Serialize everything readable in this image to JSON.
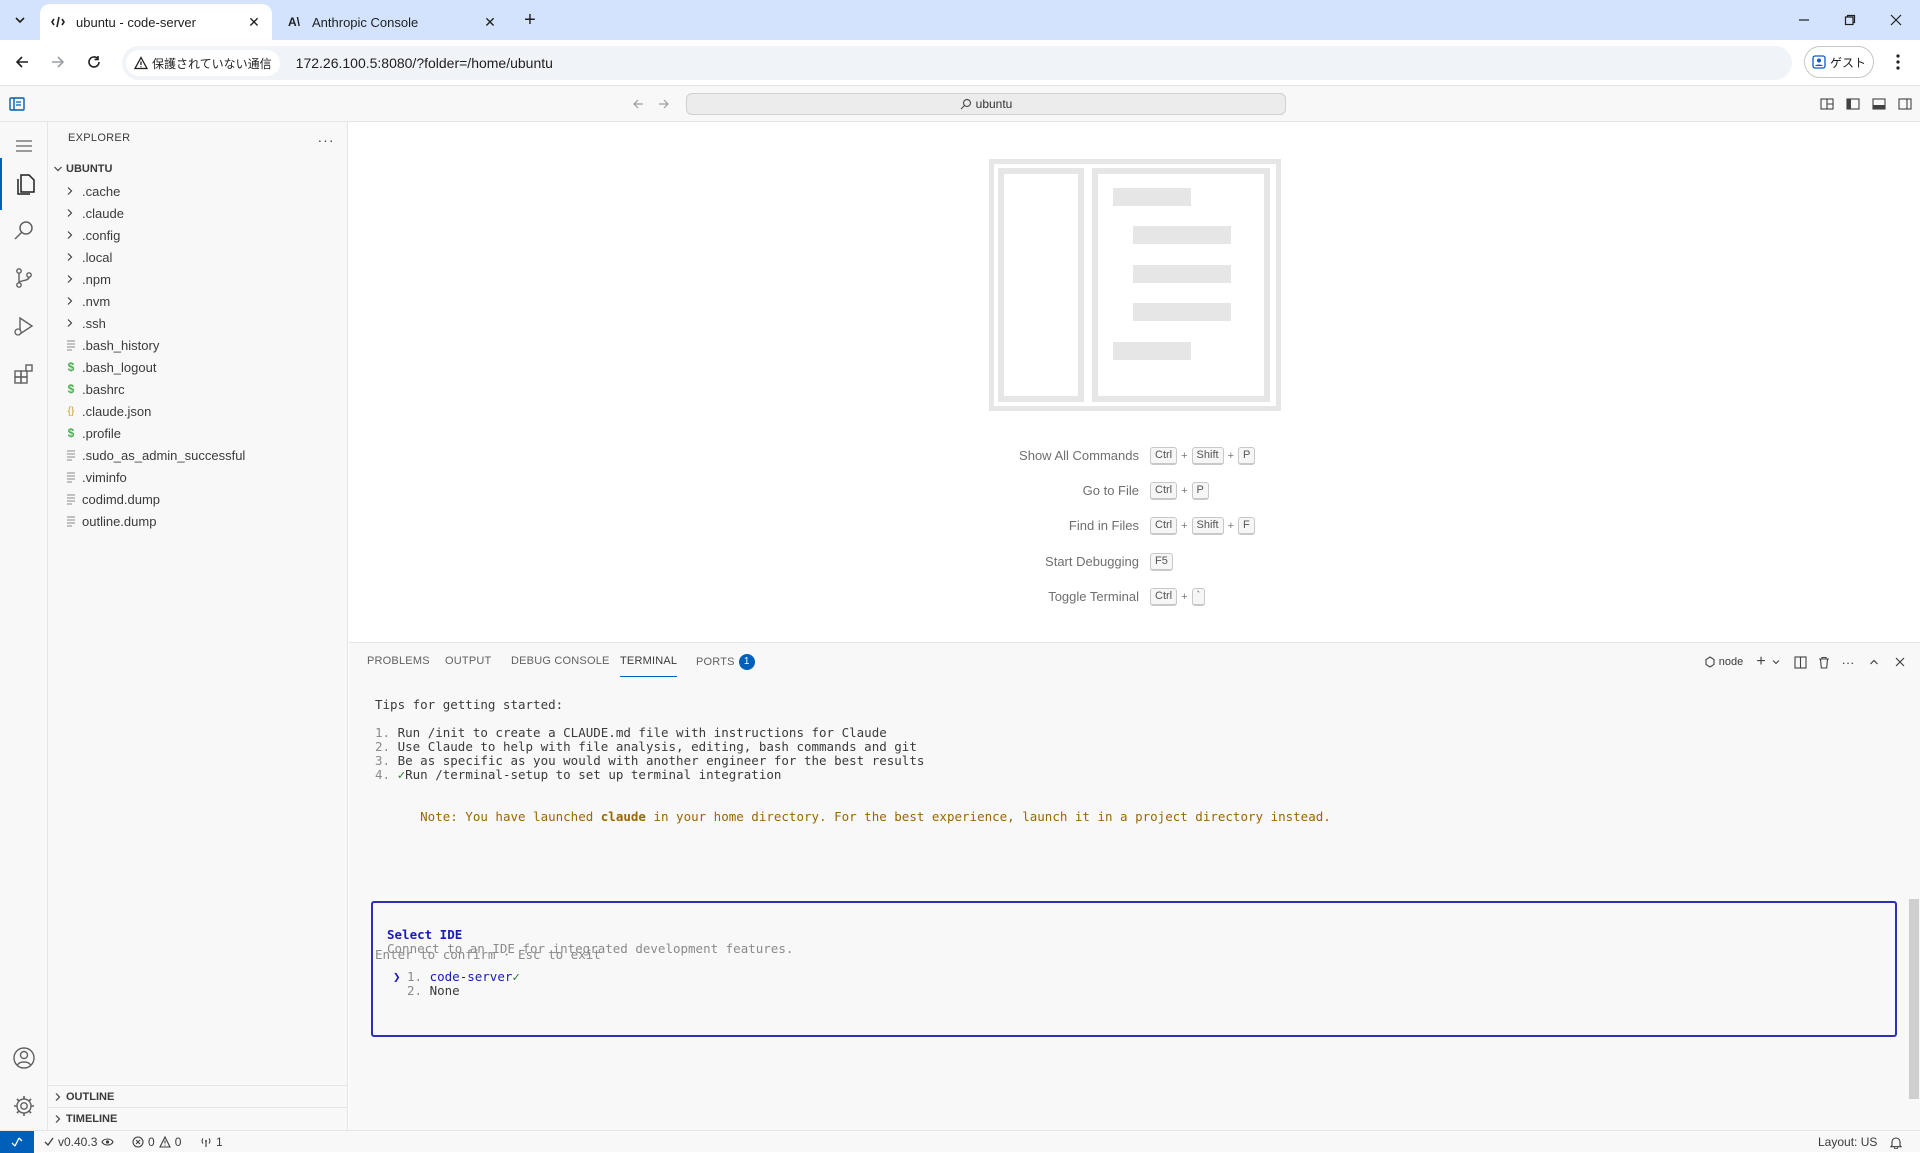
{
  "browser": {
    "tabs": [
      {
        "title": "ubuntu - code-server",
        "icon": "code-server-icon",
        "active": true
      },
      {
        "title": "Anthropic Console",
        "icon": "anthropic-icon",
        "active": false
      }
    ],
    "security_label": "保護されていない通信",
    "url": "172.26.100.5:8080/?folder=/home/ubuntu",
    "profile_label": "ゲスト"
  },
  "titlebar": {
    "command_center": "ubuntu"
  },
  "sidebar": {
    "title": "EXPLORER",
    "root": "UBUNTU",
    "folders": [
      ".cache",
      ".claude",
      ".config",
      ".local",
      ".npm",
      ".nvm",
      ".ssh"
    ],
    "files": [
      {
        "name": ".bash_history",
        "icon": "file-lines-icon"
      },
      {
        "name": ".bash_logout",
        "icon": "shell-dollar-icon"
      },
      {
        "name": ".bashrc",
        "icon": "shell-dollar-icon"
      },
      {
        "name": ".claude.json",
        "icon": "json-braces-icon"
      },
      {
        "name": ".profile",
        "icon": "shell-dollar-icon"
      },
      {
        "name": ".sudo_as_admin_successful",
        "icon": "file-lines-icon"
      },
      {
        "name": ".viminfo",
        "icon": "file-lines-icon"
      },
      {
        "name": "codimd.dump",
        "icon": "file-lines-icon"
      },
      {
        "name": "outline.dump",
        "icon": "file-lines-icon"
      }
    ],
    "outline": "OUTLINE",
    "timeline": "TIMELINE"
  },
  "editor": {
    "shortcuts": [
      {
        "label": "Show All Commands",
        "keys": [
          "Ctrl",
          "Shift",
          "P"
        ]
      },
      {
        "label": "Go to File",
        "keys": [
          "Ctrl",
          "P"
        ]
      },
      {
        "label": "Find in Files",
        "keys": [
          "Ctrl",
          "Shift",
          "F"
        ]
      },
      {
        "label": "Start Debugging",
        "keys": [
          "F5"
        ]
      },
      {
        "label": "Toggle Terminal",
        "keys": [
          "Ctrl",
          "`"
        ]
      }
    ]
  },
  "panel": {
    "tabs": [
      "PROBLEMS",
      "OUTPUT",
      "DEBUG CONSOLE",
      "TERMINAL",
      "PORTS"
    ],
    "active_tab": "TERMINAL",
    "ports_count": "1",
    "terminal_name": "node"
  },
  "terminal": {
    "tips_heading": "Tips for getting started:",
    "tips": [
      {
        "num": "1.",
        "check": "",
        "text": "Run /init to create a CLAUDE.md file with instructions for Claude"
      },
      {
        "num": "2.",
        "check": "",
        "text": "Use Claude to help with file analysis, editing, bash commands and git"
      },
      {
        "num": "3.",
        "check": "",
        "text": "Be as specific as you would with another engineer for the best results"
      },
      {
        "num": "4.",
        "check": "✓",
        "text": "Run /terminal-setup to set up terminal integration"
      }
    ],
    "note_prefix": "Note: You have launched ",
    "note_cmd": "claude",
    "note_suffix": " in your home directory. For the best experience, launch it in a project directory instead.",
    "ide_title": "Select IDE",
    "ide_subtitle": "Connect to an IDE for integrated development features.",
    "ide_options": [
      {
        "num": "1.",
        "label": "code-server",
        "check": "✓",
        "selected": true
      },
      {
        "num": "2.",
        "label": "None",
        "check": "",
        "selected": false
      }
    ],
    "pointer": "❯",
    "footer": "Enter to confirm · Esc to exit"
  },
  "statusbar": {
    "version": "v0.40.3",
    "errors": "0",
    "warnings": "0",
    "ports": "1",
    "layout": "Layout: US"
  },
  "colors": {
    "accent": "#005fb8",
    "ide_border": "#2e2eb8",
    "note": "#9a6700",
    "ide_title": "#1a1ab8",
    "option_selected": "#1a1ab8",
    "check": "#2e7d32",
    "shell_icon": "#4caf50",
    "json_icon": "#c9a227"
  }
}
